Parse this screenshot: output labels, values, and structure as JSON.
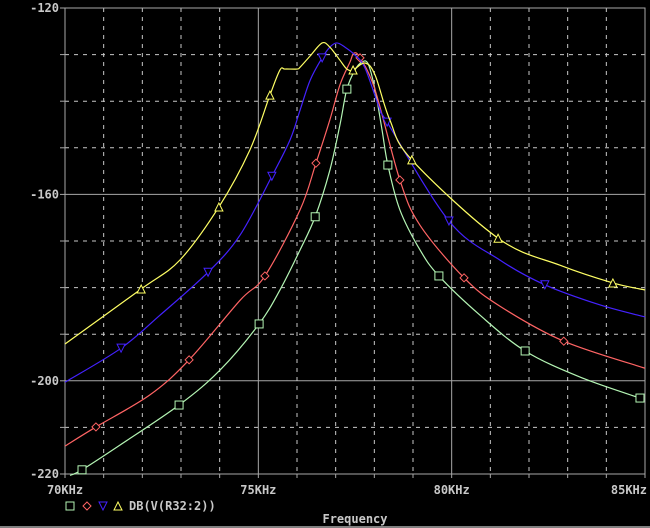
{
  "chart_data": {
    "type": "line",
    "title": "",
    "xlabel": "Frequency",
    "ylabel": "",
    "xlim": [
      70,
      85
    ],
    "ylim": [
      -220,
      -120
    ],
    "x_unit": "kHz",
    "grid": true,
    "x_ticks": [
      {
        "value": 70,
        "label": "70KHz"
      },
      {
        "value": 75,
        "label": "75KHz"
      },
      {
        "value": 80,
        "label": "80KHz"
      },
      {
        "value": 85,
        "label": "85KHz"
      }
    ],
    "y_ticks": [
      {
        "value": -120,
        "label": "-120"
      },
      {
        "value": -160,
        "label": "-160"
      },
      {
        "value": -200,
        "label": "-200"
      },
      {
        "value": -220,
        "label": "-220"
      }
    ],
    "legend": {
      "label": "DB(V(R32:2))",
      "placement": "bottom-left"
    },
    "series": [
      {
        "name": "DB(V(R32:2)) trace 1",
        "marker": "square",
        "color": "#b4f5b4",
        "points": [
          [
            70.13,
            -220.3
          ],
          [
            70.44,
            -219.1
          ],
          [
            71.42,
            -213.8
          ],
          [
            72.95,
            -205.2
          ],
          [
            74.01,
            -197.7
          ],
          [
            75.02,
            -187.8
          ],
          [
            75.56,
            -180.5
          ],
          [
            76.08,
            -171.9
          ],
          [
            76.47,
            -164.8
          ],
          [
            76.85,
            -154.8
          ],
          [
            77.11,
            -145.1
          ],
          [
            77.29,
            -137.4
          ],
          [
            77.5,
            -133.3
          ],
          [
            77.68,
            -131.6
          ],
          [
            77.84,
            -132.0
          ],
          [
            78.02,
            -137.6
          ],
          [
            78.2,
            -146.2
          ],
          [
            78.35,
            -153.7
          ],
          [
            78.66,
            -163.3
          ],
          [
            79.18,
            -171.9
          ],
          [
            79.67,
            -177.5
          ],
          [
            80.73,
            -185.9
          ],
          [
            81.9,
            -193.6
          ],
          [
            83.32,
            -199.2
          ],
          [
            84.87,
            -203.7
          ]
        ],
        "markers": [
          [
            70.44,
            -219.1
          ],
          [
            72.95,
            -205.2
          ],
          [
            75.02,
            -187.8
          ],
          [
            76.47,
            -164.8
          ],
          [
            77.29,
            -137.4
          ],
          [
            78.35,
            -153.7
          ],
          [
            79.67,
            -177.5
          ],
          [
            81.9,
            -193.6
          ],
          [
            84.87,
            -203.7
          ]
        ]
      },
      {
        "name": "DB(V(R32:2)) trace 2",
        "marker": "diamond",
        "color": "#ff6464",
        "points": [
          [
            70.0,
            -214.0
          ],
          [
            70.8,
            -209.9
          ],
          [
            72.2,
            -203.0
          ],
          [
            73.21,
            -195.5
          ],
          [
            74.53,
            -182.7
          ],
          [
            75.17,
            -177.5
          ],
          [
            76.08,
            -163.3
          ],
          [
            76.49,
            -153.3
          ],
          [
            76.85,
            -144.0
          ],
          [
            77.11,
            -136.5
          ],
          [
            77.37,
            -131.6
          ],
          [
            77.47,
            -129.7
          ],
          [
            77.63,
            -130.7
          ],
          [
            78.02,
            -137.6
          ],
          [
            78.66,
            -156.9
          ],
          [
            79.18,
            -166.6
          ],
          [
            80.32,
            -177.9
          ],
          [
            81.25,
            -184.0
          ],
          [
            82.9,
            -191.5
          ],
          [
            85.0,
            -197.3
          ]
        ],
        "markers": [
          [
            70.8,
            -209.9
          ],
          [
            73.21,
            -195.5
          ],
          [
            75.17,
            -177.5
          ],
          [
            76.49,
            -153.3
          ],
          [
            77.63,
            -130.7
          ],
          [
            78.66,
            -156.9
          ],
          [
            80.32,
            -177.9
          ],
          [
            82.9,
            -191.5
          ]
        ]
      },
      {
        "name": "DB(V(R32:2)) trace 3",
        "marker": "triangle-down",
        "color": "#4422ff",
        "points": [
          [
            70.0,
            -200.3
          ],
          [
            71.45,
            -193.0
          ],
          [
            72.46,
            -185.9
          ],
          [
            73.7,
            -176.7
          ],
          [
            74.53,
            -168.7
          ],
          [
            75.35,
            -156.1
          ],
          [
            75.82,
            -148.3
          ],
          [
            76.08,
            -141.9
          ],
          [
            76.34,
            -135.5
          ],
          [
            76.65,
            -130.7
          ],
          [
            76.85,
            -128.4
          ],
          [
            77.03,
            -127.5
          ],
          [
            77.24,
            -128.4
          ],
          [
            77.5,
            -130.1
          ],
          [
            77.76,
            -132.9
          ],
          [
            78.15,
            -141.9
          ],
          [
            78.33,
            -144.5
          ],
          [
            79.93,
            -165.7
          ],
          [
            81.25,
            -174.1
          ],
          [
            82.41,
            -179.4
          ],
          [
            83.83,
            -183.7
          ],
          [
            85.0,
            -186.3
          ]
        ],
        "markers": [
          [
            71.45,
            -193.0
          ],
          [
            73.7,
            -176.7
          ],
          [
            75.35,
            -156.1
          ],
          [
            76.65,
            -130.7
          ],
          [
            78.33,
            -144.5
          ],
          [
            79.93,
            -165.7
          ],
          [
            82.41,
            -179.4
          ]
        ]
      },
      {
        "name": "DB(V(R32:2)) trace 4",
        "marker": "triangle-up",
        "color": "#ffff64",
        "points": [
          [
            70.0,
            -192.1
          ],
          [
            71.97,
            -180.3
          ],
          [
            72.97,
            -174.1
          ],
          [
            73.98,
            -162.7
          ],
          [
            74.78,
            -150.5
          ],
          [
            75.3,
            -138.7
          ],
          [
            75.56,
            -133.3
          ],
          [
            75.69,
            -133.1
          ],
          [
            76.0,
            -133.1
          ],
          [
            76.08,
            -132.7
          ],
          [
            76.34,
            -130.3
          ],
          [
            76.65,
            -127.5
          ],
          [
            76.85,
            -128.4
          ],
          [
            77.11,
            -131.2
          ],
          [
            77.29,
            -133.1
          ],
          [
            77.45,
            -133.3
          ],
          [
            77.76,
            -131.8
          ],
          [
            78.02,
            -134.4
          ],
          [
            78.4,
            -144.0
          ],
          [
            78.97,
            -152.6
          ],
          [
            81.2,
            -169.4
          ],
          [
            82.8,
            -175.2
          ],
          [
            84.17,
            -179.0
          ],
          [
            85.0,
            -180.5
          ]
        ],
        "markers": [
          [
            71.97,
            -180.3
          ],
          [
            73.98,
            -162.7
          ],
          [
            75.3,
            -138.7
          ],
          [
            77.45,
            -133.3
          ],
          [
            78.97,
            -152.6
          ],
          [
            81.2,
            -169.4
          ],
          [
            84.17,
            -179.0
          ]
        ]
      }
    ]
  }
}
